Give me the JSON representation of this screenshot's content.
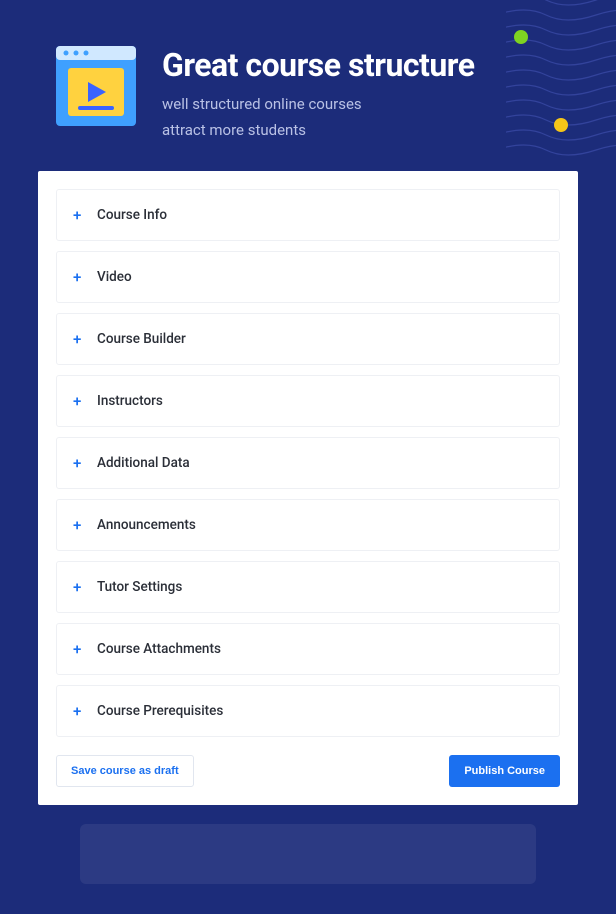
{
  "header": {
    "title": "Great course structure",
    "subtitle_line1": "well structured online courses",
    "subtitle_line2": "attract more students"
  },
  "sections": [
    {
      "label": "Course Info"
    },
    {
      "label": "Video"
    },
    {
      "label": "Course Builder"
    },
    {
      "label": "Instructors"
    },
    {
      "label": "Additional Data"
    },
    {
      "label": "Announcements"
    },
    {
      "label": "Tutor Settings"
    },
    {
      "label": "Course Attachments"
    },
    {
      "label": "Course Prerequisites"
    }
  ],
  "actions": {
    "draft": "Save course as draft",
    "publish": "Publish Course"
  }
}
